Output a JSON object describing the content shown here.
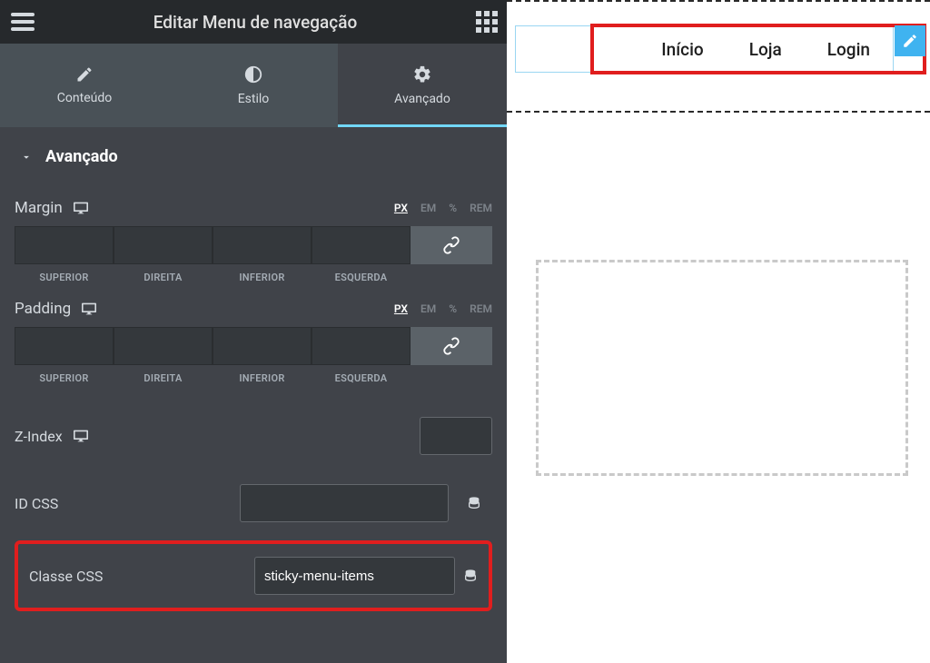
{
  "header": {
    "title": "Editar Menu de navegação"
  },
  "tabs": [
    {
      "label": "Conteúdo"
    },
    {
      "label": "Estilo"
    },
    {
      "label": "Avançado"
    }
  ],
  "section": {
    "title": "Avançado"
  },
  "spacing": {
    "margin_label": "Margin",
    "padding_label": "Padding",
    "units": {
      "px": "PX",
      "em": "EM",
      "pct": "%",
      "rem": "REM"
    },
    "sides": {
      "top": "SUPERIOR",
      "right": "DIREITA",
      "bottom": "INFERIOR",
      "left": "ESQUERDA"
    },
    "margin": {
      "top": "",
      "right": "",
      "bottom": "",
      "left": ""
    },
    "padding": {
      "top": "",
      "right": "",
      "bottom": "",
      "left": ""
    }
  },
  "zindex": {
    "label": "Z-Index",
    "value": ""
  },
  "idcss": {
    "label": "ID CSS",
    "value": ""
  },
  "classecss": {
    "label": "Classe CSS",
    "value": "sticky-menu-items"
  },
  "preview": {
    "menu": {
      "inicio": "Início",
      "loja": "Loja",
      "login": "Login"
    }
  }
}
